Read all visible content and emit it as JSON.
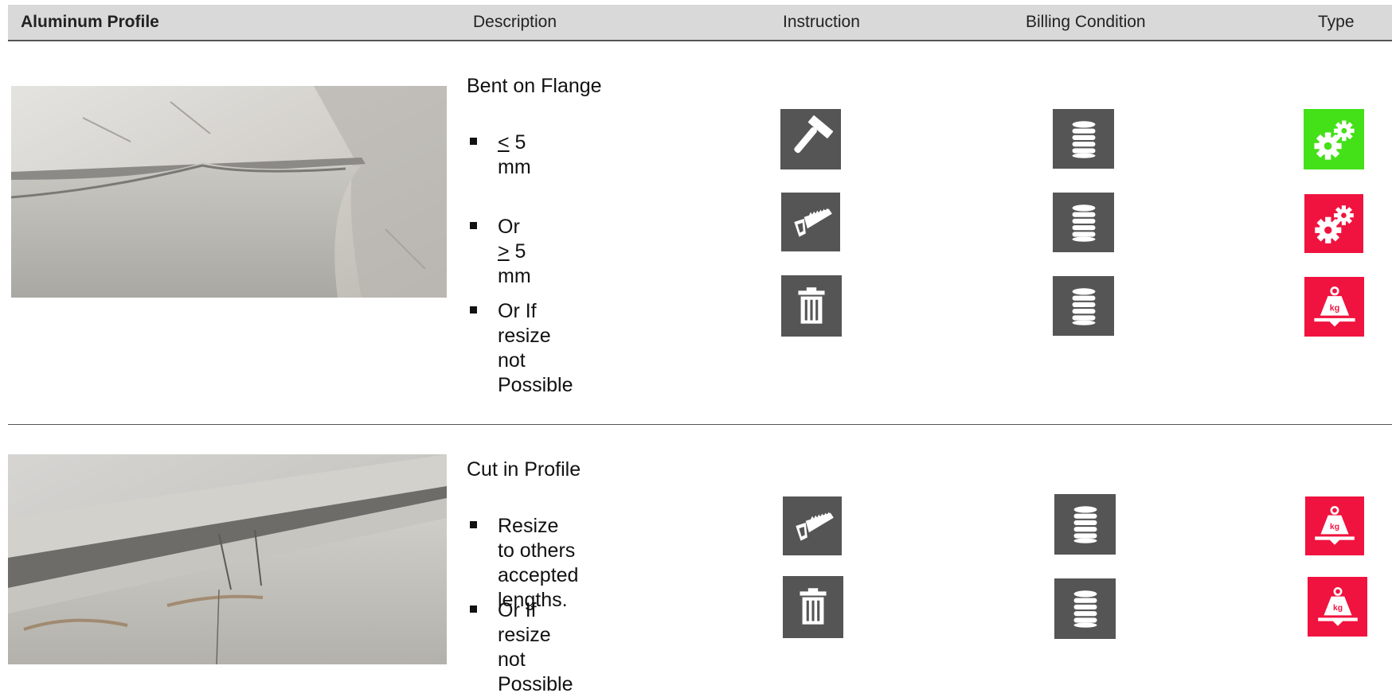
{
  "header": {
    "col1": "Aluminum Profile",
    "col2": "Description",
    "col3": "Instruction",
    "col4": "Billing Condition",
    "col5": "Type"
  },
  "colors": {
    "header_bg": "#d9d9d9",
    "icon_dark": "#555555",
    "type_green": "#44e018",
    "type_red": "#f0133f"
  },
  "sections": [
    {
      "title": "Bent on Flange",
      "rows": [
        {
          "pre": "",
          "symbol": "<",
          "post": " 5 mm",
          "instruction_icon": "hammer-icon",
          "billing_icon": "coin-stack-icon",
          "type_icon": "gears-icon",
          "type_color": "green"
        },
        {
          "pre": "Or ",
          "symbol": ">",
          "post": " 5 mm",
          "instruction_icon": "saw-icon",
          "billing_icon": "coin-stack-icon",
          "type_icon": "gears-icon",
          "type_color": "red"
        },
        {
          "text": "Or If resize not Possible",
          "instruction_icon": "trash-icon",
          "billing_icon": "coin-stack-icon",
          "type_icon": "kg-weight-icon",
          "type_color": "red"
        }
      ]
    },
    {
      "title": "Cut in Profile",
      "rows": [
        {
          "line1": "Resize to others accepted",
          "line2": "lengths.",
          "instruction_icon": "saw-icon",
          "billing_icon": "coin-stack-icon",
          "type_icon": "kg-weight-icon",
          "type_color": "red"
        },
        {
          "text": "Or If resize not Possible",
          "instruction_icon": "trash-icon",
          "billing_icon": "coin-stack-icon",
          "type_icon": "kg-weight-icon",
          "type_color": "red"
        }
      ]
    }
  ]
}
